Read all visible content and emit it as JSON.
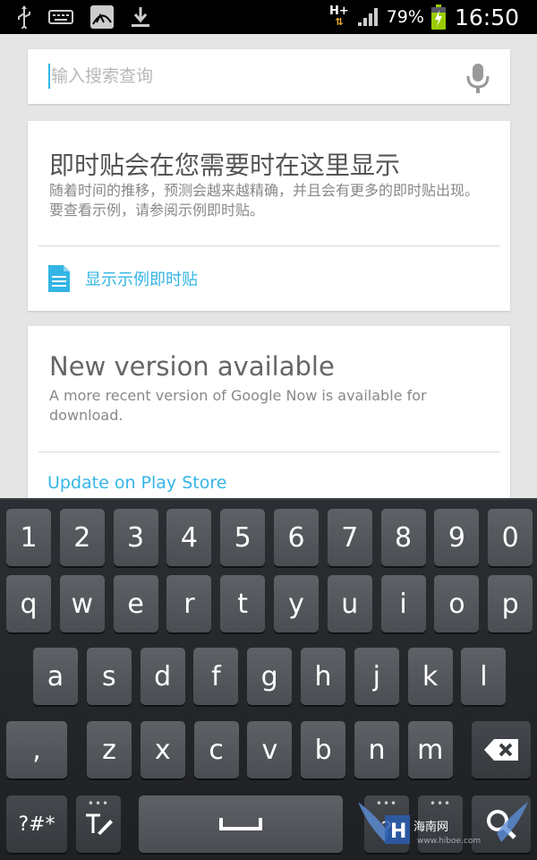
{
  "status_bar": {
    "network_type": "H+",
    "battery_percent": "79%",
    "time": "16:50",
    "icons": [
      "usb-icon",
      "keyboard-icon",
      "gallery-icon",
      "download-icon",
      "signal-icon",
      "battery-charging-icon"
    ]
  },
  "search": {
    "placeholder": "输入搜索查询",
    "value": ""
  },
  "card_now": {
    "title": "即时贴会在您需要时在这里显示",
    "body": "随着时间的推移，预测会越来越精确，并且会有更多的即时贴出现。要查看示例，请参阅示例即时贴。",
    "action_label": "显示示例即时贴"
  },
  "card_update": {
    "title": "New version available",
    "body": "A more recent version of Google Now is available for download.",
    "action_label": "Update on Play Store"
  },
  "keyboard": {
    "row_numbers": [
      "1",
      "2",
      "3",
      "4",
      "5",
      "6",
      "7",
      "8",
      "9",
      "0"
    ],
    "row_top": [
      "q",
      "w",
      "e",
      "r",
      "t",
      "y",
      "u",
      "i",
      "o",
      "p"
    ],
    "row_middle": [
      "a",
      "s",
      "d",
      "f",
      "g",
      "h",
      "j",
      "k",
      "l"
    ],
    "row_bottom": [
      ",",
      "z",
      "x",
      "c",
      "v",
      "b",
      "n",
      "m"
    ],
    "symbols_label": "?#*",
    "settings_label": "T",
    "punct_label": "?"
  },
  "watermark": {
    "text": "海南网",
    "url": "www.hiboe.com"
  },
  "colors": {
    "accent": "#33b5e5",
    "background": "#e5e5e5",
    "keyboard": "#26292d"
  }
}
